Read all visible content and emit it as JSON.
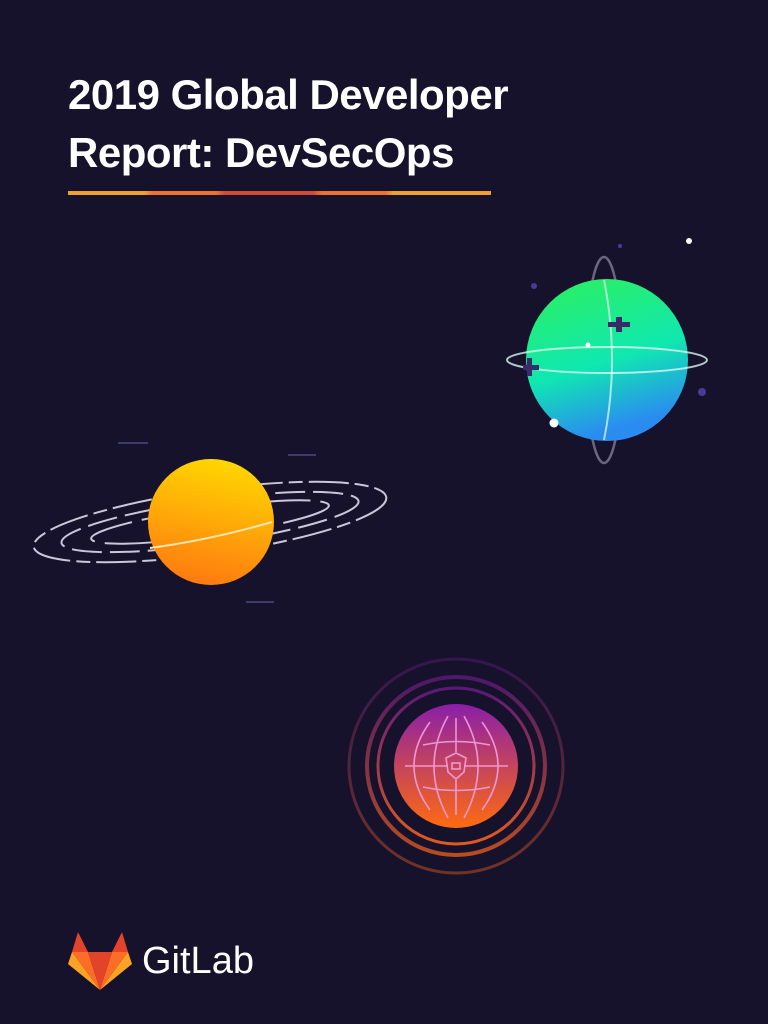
{
  "cover": {
    "title_line1": "2019 Global Developer",
    "title_line2": "Report: DevSecOps",
    "brand": "GitLab"
  },
  "colors": {
    "background": "#16122b",
    "accent_orange": "#ec7232",
    "accent_yellow": "#f0a030"
  }
}
